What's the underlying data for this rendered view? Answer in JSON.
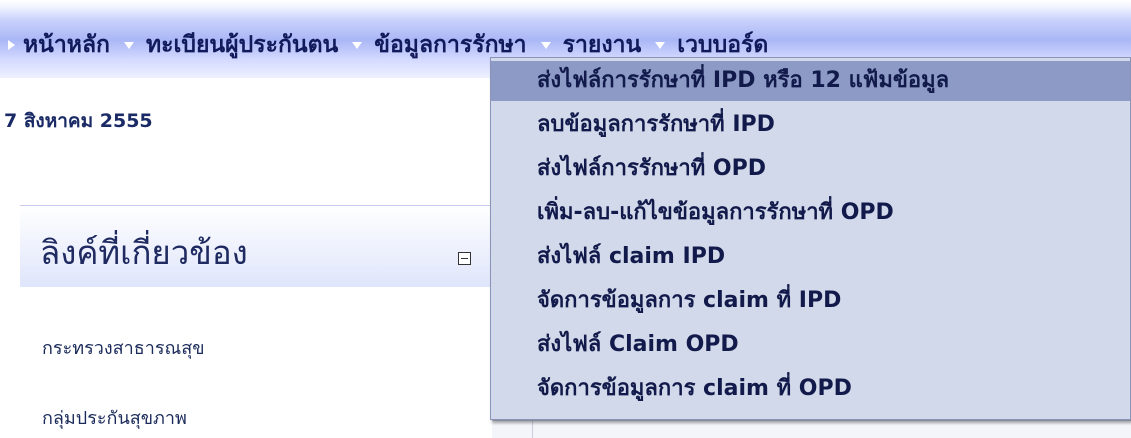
{
  "nav": {
    "items": [
      {
        "label": "หน้าหลัก"
      },
      {
        "label": "ทะเบียนผู้ประกันตน"
      },
      {
        "label": "ข้อมูลการรักษา"
      },
      {
        "label": "รายงาน"
      },
      {
        "label": "เวบบอร์ด"
      }
    ]
  },
  "date_text": "7 สิงหาคม 2555",
  "links_panel": {
    "title": "ลิงค์ที่เกี่ยวข้อง",
    "links": [
      "กระทรวงสาธารณสุข",
      "กลุ่มประกันสุขภาพ"
    ]
  },
  "dropdown": {
    "items": [
      "ส่งไฟล์การรักษาที่ IPD หรือ 12 แฟ้มข้อมูล",
      "ลบข้อมูลการรักษาที่ IPD",
      "ส่งไฟล์การรักษาที่ OPD",
      "เพิ่ม-ลบ-แก้ไขข้อมูลการรักษาที่ OPD",
      "ส่งไฟล์ claim IPD",
      "จัดการข้อมูลการ claim ที่ IPD",
      "ส่งไฟล์ Claim OPD",
      "จัดการข้อมูลการ claim ที่ OPD"
    ],
    "active_index": 0
  }
}
